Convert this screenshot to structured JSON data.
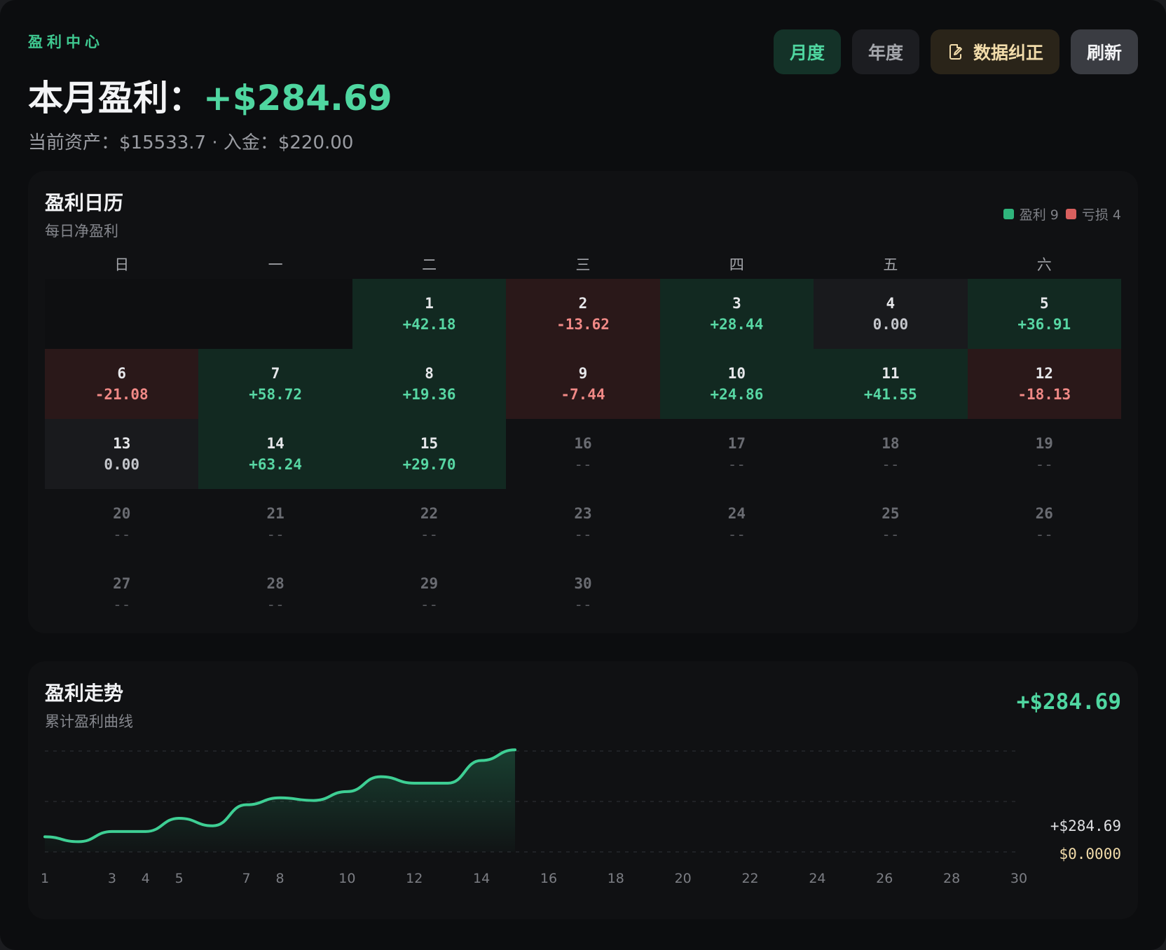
{
  "header": {
    "eyebrow": "盈利中心",
    "headline_label": "本月盈利：",
    "headline_amount": "+$284.69",
    "subline": "当前资产：$15533.7 · 入金：$220.00"
  },
  "toolbar": {
    "monthly": "月度",
    "yearly": "年度",
    "correct": "数据纠正",
    "refresh": "刷新"
  },
  "colors": {
    "profit": "#4fd6a0",
    "loss": "#f08986",
    "profit_bg": "#122921",
    "loss_bg": "#2a1819"
  },
  "calendar": {
    "title": "盈利日历",
    "subtitle": "每日净盈利",
    "legend_profit": "盈利 9",
    "legend_loss": "亏损 4",
    "weekdays": [
      "日",
      "一",
      "二",
      "三",
      "四",
      "五",
      "六"
    ],
    "leading_blanks": 2,
    "days": [
      {
        "day": "1",
        "value": "+42.18",
        "state": "profit"
      },
      {
        "day": "2",
        "value": "-13.62",
        "state": "loss"
      },
      {
        "day": "3",
        "value": "+28.44",
        "state": "profit"
      },
      {
        "day": "4",
        "value": "0.00",
        "state": "zero"
      },
      {
        "day": "5",
        "value": "+36.91",
        "state": "profit"
      },
      {
        "day": "6",
        "value": "-21.08",
        "state": "loss"
      },
      {
        "day": "7",
        "value": "+58.72",
        "state": "profit"
      },
      {
        "day": "8",
        "value": "+19.36",
        "state": "profit"
      },
      {
        "day": "9",
        "value": "-7.44",
        "state": "loss"
      },
      {
        "day": "10",
        "value": "+24.86",
        "state": "profit"
      },
      {
        "day": "11",
        "value": "+41.55",
        "state": "profit"
      },
      {
        "day": "12",
        "value": "-18.13",
        "state": "loss"
      },
      {
        "day": "13",
        "value": "0.00",
        "state": "zero"
      },
      {
        "day": "14",
        "value": "+63.24",
        "state": "profit"
      },
      {
        "day": "15",
        "value": "+29.70",
        "state": "profit"
      },
      {
        "day": "16",
        "value": "--",
        "state": "future"
      },
      {
        "day": "17",
        "value": "--",
        "state": "future"
      },
      {
        "day": "18",
        "value": "--",
        "state": "future"
      },
      {
        "day": "19",
        "value": "--",
        "state": "future"
      },
      {
        "day": "20",
        "value": "--",
        "state": "future"
      },
      {
        "day": "21",
        "value": "--",
        "state": "future"
      },
      {
        "day": "22",
        "value": "--",
        "state": "future"
      },
      {
        "day": "23",
        "value": "--",
        "state": "future"
      },
      {
        "day": "24",
        "value": "--",
        "state": "future"
      },
      {
        "day": "25",
        "value": "--",
        "state": "future"
      },
      {
        "day": "26",
        "value": "--",
        "state": "future"
      },
      {
        "day": "27",
        "value": "--",
        "state": "future"
      },
      {
        "day": "28",
        "value": "--",
        "state": "future"
      },
      {
        "day": "29",
        "value": "--",
        "state": "future"
      },
      {
        "day": "30",
        "value": "--",
        "state": "future"
      }
    ]
  },
  "trend": {
    "title": "盈利走势",
    "subtitle": "累计盈利曲线",
    "total": "+$284.69"
  },
  "chart_data": {
    "type": "area",
    "x": [
      1,
      2,
      3,
      4,
      5,
      6,
      7,
      8,
      9,
      10,
      11,
      12,
      13,
      14,
      15
    ],
    "values": [
      42.18,
      28.56,
      57.0,
      57.0,
      93.91,
      72.83,
      131.55,
      150.91,
      143.47,
      168.33,
      209.88,
      191.75,
      191.75,
      254.99,
      284.69
    ],
    "xlim": [
      1,
      30
    ],
    "x_tick_labels": [
      "1",
      "3",
      "4",
      "5",
      "7",
      "8",
      "10",
      "12",
      "14",
      "16",
      "18",
      "20",
      "22",
      "24",
      "26",
      "28",
      "30"
    ],
    "x_tick_values": [
      1,
      3,
      4,
      5,
      7,
      8,
      10,
      12,
      14,
      16,
      18,
      20,
      22,
      24,
      26,
      28,
      30
    ],
    "y_labels": [
      {
        "text": "+$284.69",
        "value": 284.69
      },
      {
        "text": "$0.0000",
        "value": 0
      }
    ],
    "grid": true
  }
}
